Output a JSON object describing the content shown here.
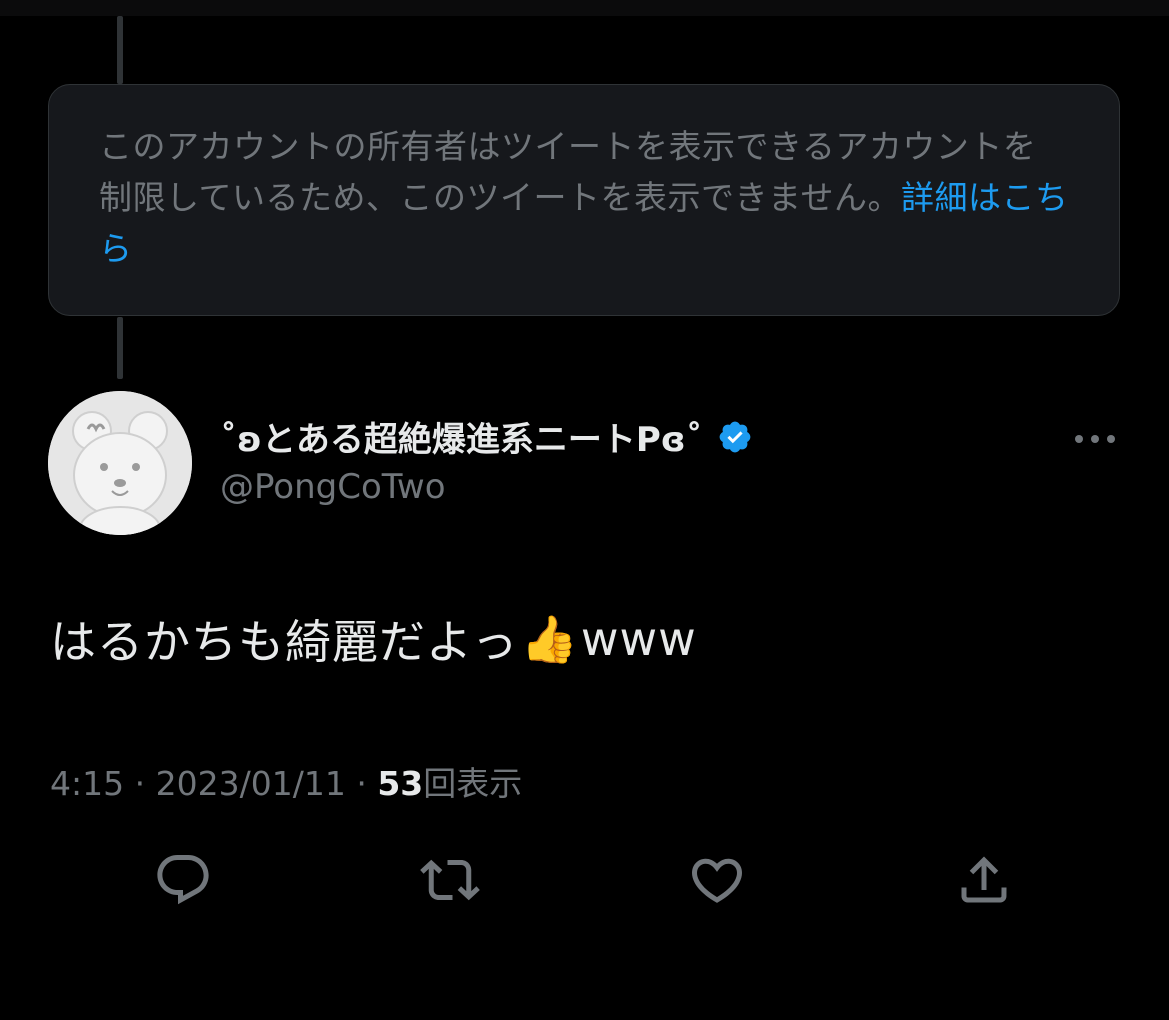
{
  "notice": {
    "text": "このアカウントの所有者はツイートを表示できるアカウントを制限しているため、このツイートを表示できません。",
    "link_label": "詳細はこちら"
  },
  "tweet": {
    "author_name": "˚ʚとある超絶爆進系ニートPɞ˚",
    "author_handle": "@PongCoTwo",
    "verified": true,
    "text_main": "はるかちも綺麗だよっ",
    "text_emoji": "👍",
    "text_suffix": "www",
    "time": "4:15",
    "separator": "·",
    "date": "2023/01/11",
    "views_count": "53",
    "views_label": "回表示"
  },
  "icons": {
    "more": "more-horizontal-icon",
    "reply": "reply-icon",
    "retweet": "retweet-icon",
    "like": "heart-icon",
    "share": "share-icon",
    "verified": "verified-badge-icon"
  },
  "colors": {
    "background": "#000000",
    "card": "#16181c",
    "border": "#2f3336",
    "text": "#e7e9ea",
    "muted": "#71767b",
    "link": "#1d9bf0"
  }
}
